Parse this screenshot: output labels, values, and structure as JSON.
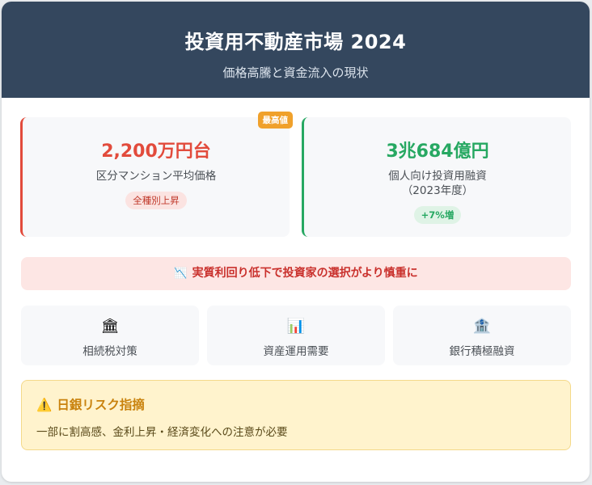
{
  "header": {
    "title": "投資用不動産市場 2024",
    "subtitle": "価格高騰と資金流入の現状"
  },
  "stats": [
    {
      "value": "2,200万円台",
      "label": "区分マンション平均価格",
      "label2": "",
      "pill": "全種別上昇",
      "badge": "最高値",
      "accent": "#e24b3c"
    },
    {
      "value": "3兆684億円",
      "label": "個人向け投資用融資",
      "label2": "（2023年度）",
      "pill": "+7%増",
      "badge": "",
      "accent": "#27a862"
    }
  ],
  "alert": {
    "icon": "chart-down-icon",
    "text": "実質利回り低下で投資家の選択がより慎重に"
  },
  "factors": [
    {
      "icon": "bank-icon",
      "label": "相続税対策"
    },
    {
      "icon": "bar-chart-icon",
      "label": "資産運用需要"
    },
    {
      "icon": "bank-building-icon",
      "label": "銀行積極融資"
    }
  ],
  "warning": {
    "icon": "warning-icon",
    "title": "日銀リスク指摘",
    "text": "一部に割高感、金利上昇・経済変化への注意が必要"
  },
  "colors": {
    "header_bg": "#34475e",
    "red": "#e24b3c",
    "green": "#27a862",
    "badge": "#f0a12b",
    "warning_bg": "#fff3cd"
  }
}
